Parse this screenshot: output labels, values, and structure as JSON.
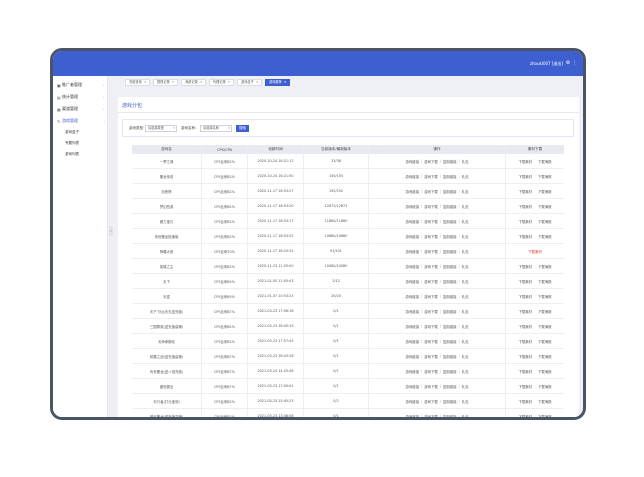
{
  "header": {
    "user": "zhoukl007 [退出]"
  },
  "sidebar": {
    "items": [
      {
        "label": "推广者管理",
        "icon": "user-icon"
      },
      {
        "label": "统计管理",
        "icon": "chart-icon"
      },
      {
        "label": "渠道管理",
        "icon": "channel-icon"
      },
      {
        "label": "游戏管理",
        "icon": "edit-icon"
      }
    ],
    "subitems": [
      "游戏盒子",
      "专题列表",
      "游戏列表"
    ]
  },
  "tabs": [
    {
      "label": "充值查询"
    },
    {
      "label": "提现记录"
    },
    {
      "label": "消费记录"
    },
    {
      "label": "代理记录"
    },
    {
      "label": "游戏盒子"
    },
    {
      "label": "游戏推荐"
    }
  ],
  "panel": {
    "title": "游戏分包"
  },
  "filter": {
    "label1": "游戏类型：",
    "select1": "请选择类型",
    "label2": "游戏名称：",
    "select2": "请选择名称",
    "search_label": "搜索"
  },
  "table": {
    "headers": [
      "游戏名",
      "CPS/CPA",
      "创新时间",
      "当前版本/最新版本",
      "操作",
      "素材下载"
    ],
    "op_labels": [
      "游戏链接",
      "游戏下载",
      "复制链接",
      "礼包"
    ],
    "dl_labels": [
      "下载素材",
      "下载海报"
    ],
    "dl_error": "下载素材",
    "rows": [
      {
        "name": "一梦江湖",
        "cps": "CPS比例82%",
        "time": "2020-10-24 16:21:12",
        "ver": "33/38",
        "dl_error": false
      },
      {
        "name": "屠龙传说",
        "cps": "CPS比例82%",
        "time": "2020-10-24 16:21:50",
        "ver": "145/155",
        "dl_error": false
      },
      {
        "name": "剑侠情",
        "cps": "CPS比例82%",
        "time": "2020-11-17 16:53:27",
        "ver": "192/192",
        "dl_error": false
      },
      {
        "name": "梦幻西游",
        "cps": "CPS比例82%",
        "time": "2020-11-17 16:53:20",
        "ver": "12872/12872",
        "dl_error": false
      },
      {
        "name": "魔力宝贝",
        "cps": "CPS比例82%",
        "time": "2020-11-17 16:53:17",
        "ver": "11880/11880",
        "dl_error": false
      },
      {
        "name": "传世屠龙极速版",
        "cps": "CPS比例82%",
        "time": "2020-11-17 16:53:52",
        "ver": "10680/10680",
        "dl_error": false
      },
      {
        "name": "神雕大侠",
        "cps": "CPS比例70%",
        "time": "2020-11-17 16:20:31",
        "ver": "91/101",
        "dl_error": true
      },
      {
        "name": "英雄之主",
        "cps": "CPS比例82%",
        "time": "2020-11-23 11:25:00",
        "ver": "10080/10080",
        "dl_error": false
      },
      {
        "name": "天下",
        "cps": "CPS比例65%",
        "time": "2021-01-05 11:05:43",
        "ver": "2/12",
        "dl_error": false
      },
      {
        "name": "天涯",
        "cps": "CPS比例65%",
        "time": "2021-01-07 10:53:23",
        "ver": "20/20",
        "dl_error": false
      },
      {
        "name": "天下飞仙(天天送充值)",
        "cps": "CPS比例87%",
        "time": "2021-03-23 17:56:16",
        "ver": "0/1",
        "dl_error": false
      },
      {
        "name": "三国群英(送充值高爆)",
        "cps": "CPS比例82%",
        "time": "2021-03-23 18:00:33",
        "ver": "0/1",
        "dl_error": false
      },
      {
        "name": "天命奇御化",
        "cps": "CPS比例82%",
        "time": "2021-03-23 17:57:43",
        "ver": "0/1",
        "dl_error": false
      },
      {
        "name": "射雕之战(送充值高爆)",
        "cps": "CPS比例87%",
        "time": "2021-03-23 18:03:28",
        "ver": "0/1",
        "dl_error": false
      },
      {
        "name": "传世屠龙(送八倍充值)",
        "cps": "CPS比例87%",
        "time": "2021-03-24 14:25:46",
        "ver": "0/1",
        "dl_error": false
      },
      {
        "name": "盛世霸业",
        "cps": "CPS比例87%",
        "time": "2021-03-23 17:00:01",
        "ver": "0/1",
        "dl_error": false
      },
      {
        "name": "天行者(打元宝领)",
        "cps": "CPS比例82%",
        "time": "2021-03-23 15:45:23",
        "ver": "0/2",
        "dl_error": false
      },
      {
        "name": "倚天屠龙(送充值高爆)",
        "cps": "CPS比例82%",
        "time": "2021-03-23 13:48:08",
        "ver": "0/1",
        "dl_error": false
      }
    ]
  },
  "colors": {
    "primary": "#3d5fcf",
    "error": "#e0302a",
    "frame": "#4c5566"
  }
}
